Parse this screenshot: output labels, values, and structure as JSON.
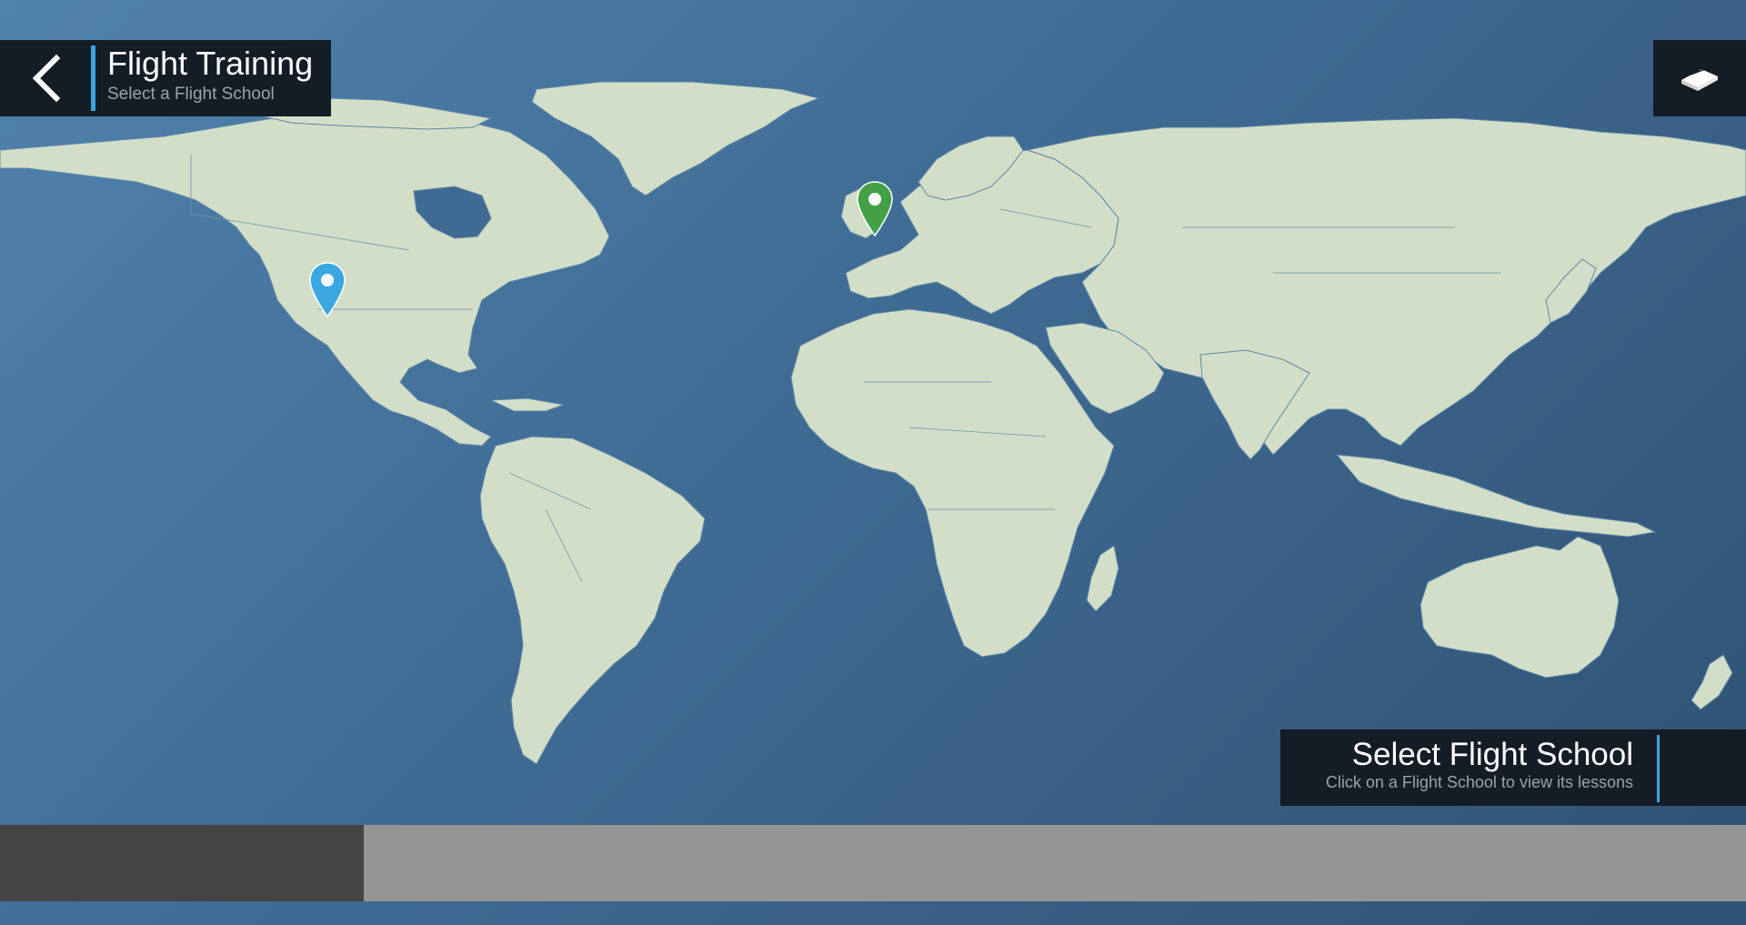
{
  "header": {
    "title": "Flight Training",
    "subtitle": "Select a Flight School",
    "back_icon": "chevron-left-icon",
    "accent_color": "#3aa7e0"
  },
  "top_right": {
    "icon": "book-icon"
  },
  "map": {
    "background_color": "#3f6b93",
    "land_color": "#d3dec8",
    "pins": [
      {
        "name": "flight-school-usa",
        "color": "#3aa7e0"
      },
      {
        "name": "flight-school-europe",
        "color": "#43a047"
      }
    ]
  },
  "info_panel": {
    "title": "Select Flight School",
    "subtitle": "Click on a Flight School to view its lessons"
  },
  "bottom_bar": {
    "left_color": "#444444",
    "right_color": "#959595"
  }
}
